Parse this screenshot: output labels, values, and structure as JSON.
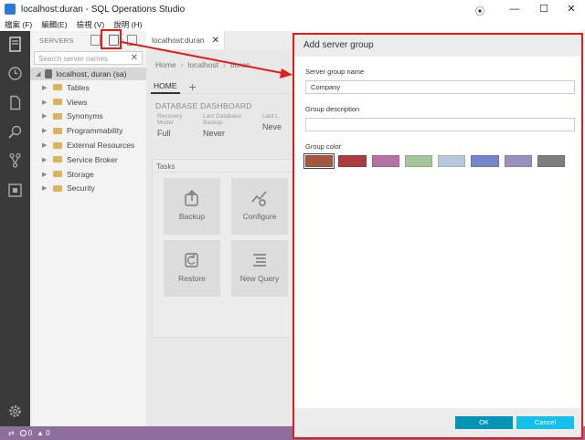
{
  "window": {
    "title": "localhost:duran - SQL Operations Studio",
    "pin_icon": "pin-icon",
    "minimize": "—",
    "maximize": "☐",
    "close": "✕"
  },
  "menu": [
    "檔案 (F)",
    "編輯(E)",
    "檢視 (V)",
    "說明 (H)"
  ],
  "activity_bar": {
    "icons": [
      "servers-icon",
      "history-icon",
      "file-icon",
      "search-icon",
      "git-icon",
      "extensions-icon",
      "settings-icon"
    ]
  },
  "sidebar": {
    "header": "SERVERS",
    "search_placeholder": "Search server names",
    "search_clear": "✕",
    "server": "localhost, duran (sa)",
    "items": [
      "Tables",
      "Views",
      "Synonyms",
      "Programmability",
      "External Resources",
      "Service Broker",
      "Storage",
      "Security"
    ]
  },
  "editor": {
    "tab": "localhost:duran",
    "tab_close": "✕",
    "breadcrumb": [
      "Home",
      "localhost",
      "duran"
    ],
    "home_tab": "HOME",
    "add_tab": "+",
    "dashboard_title": "DATABASE DASHBOARD",
    "properties": [
      {
        "label": "Recovery Model",
        "value": "Full"
      },
      {
        "label": "Last Database Backup",
        "value": "Never"
      },
      {
        "label": "Last L",
        "value": "Neve"
      }
    ],
    "tasks_header": "Tasks",
    "tasks": [
      "Backup",
      "Configure",
      "Restore",
      "New Query"
    ]
  },
  "status_bar": {
    "errors": "0",
    "warnings": "0"
  },
  "dialog": {
    "title": "Add server group",
    "name_label": "Server group name",
    "name_value": "Company",
    "description_label": "Group description",
    "description_value": "",
    "color_label": "Group color",
    "colors": [
      "#a4573f",
      "#aa3d3f",
      "#b472a5",
      "#a3c79b",
      "#b7c8dc",
      "#7784c8",
      "#9b8fbe",
      "#7d7d7d"
    ],
    "selected_color_index": 0,
    "ok_label": "OK",
    "cancel_label": "Cancel"
  },
  "annotation_color": "#e51b1b"
}
